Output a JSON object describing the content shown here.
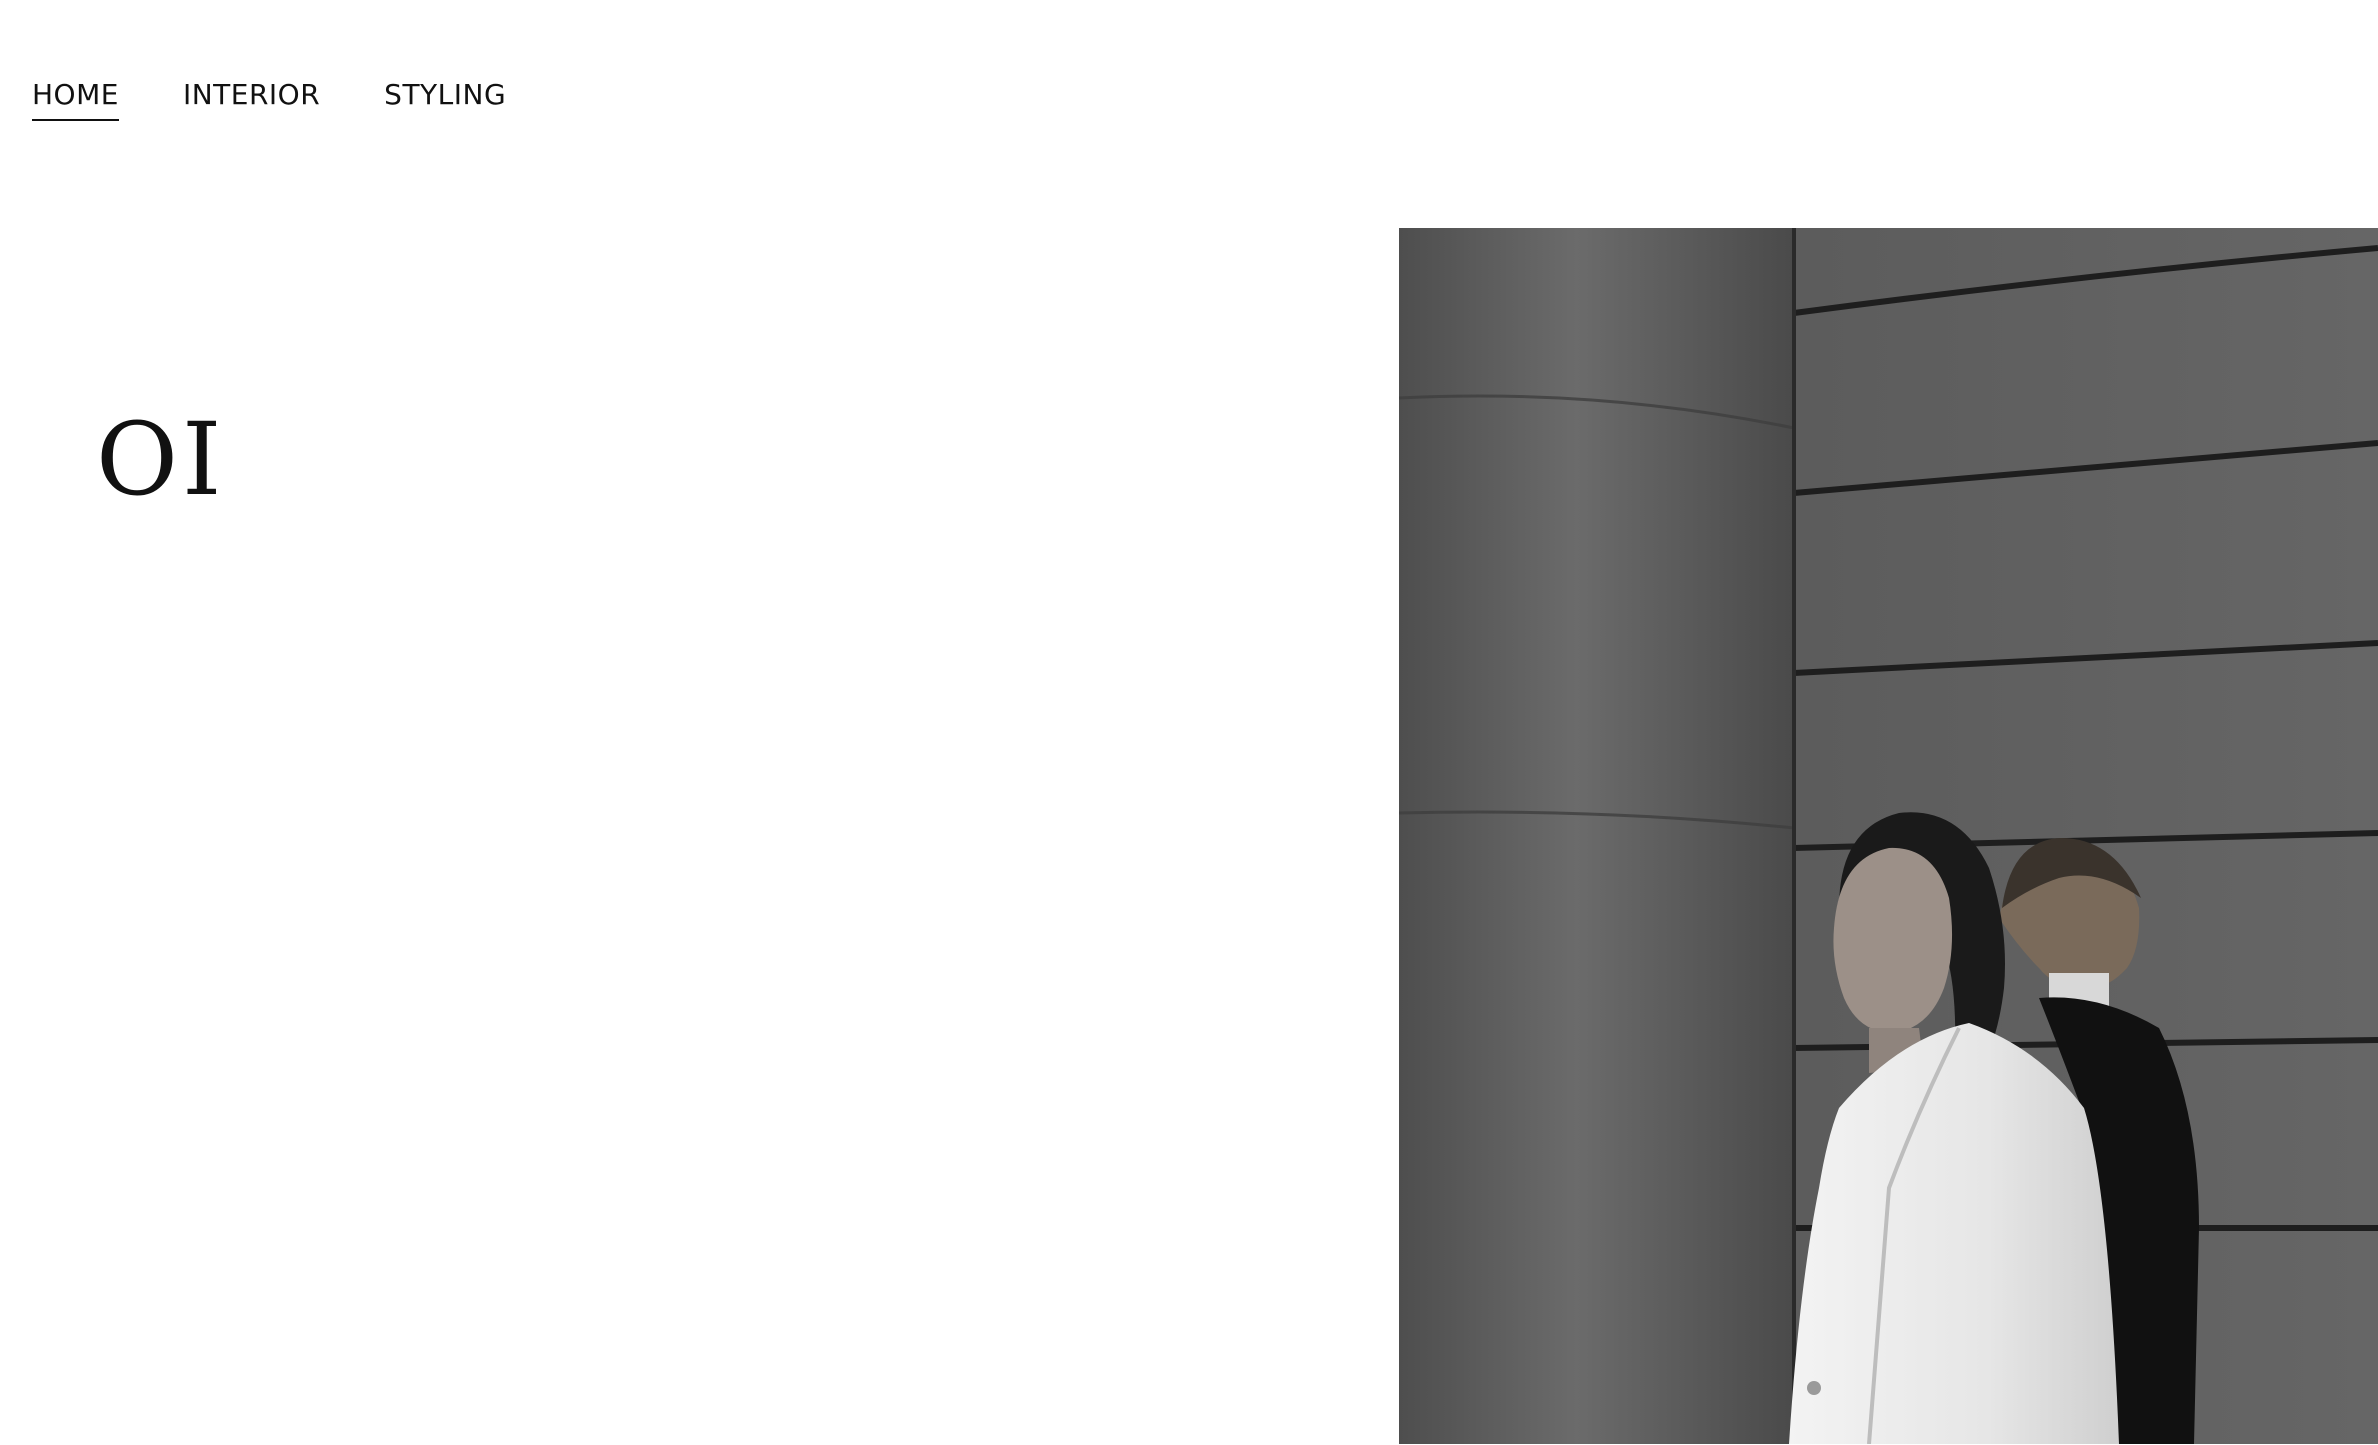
{
  "nav": {
    "items": [
      {
        "label": "HOME",
        "active": true
      },
      {
        "label": "INTERIOR",
        "active": false
      },
      {
        "label": "STYLING",
        "active": false
      }
    ]
  },
  "hero": {
    "number": "OI",
    "image_description_icon": "photo-couple-columns"
  },
  "colors": {
    "text": "#111111",
    "background": "#ffffff"
  }
}
